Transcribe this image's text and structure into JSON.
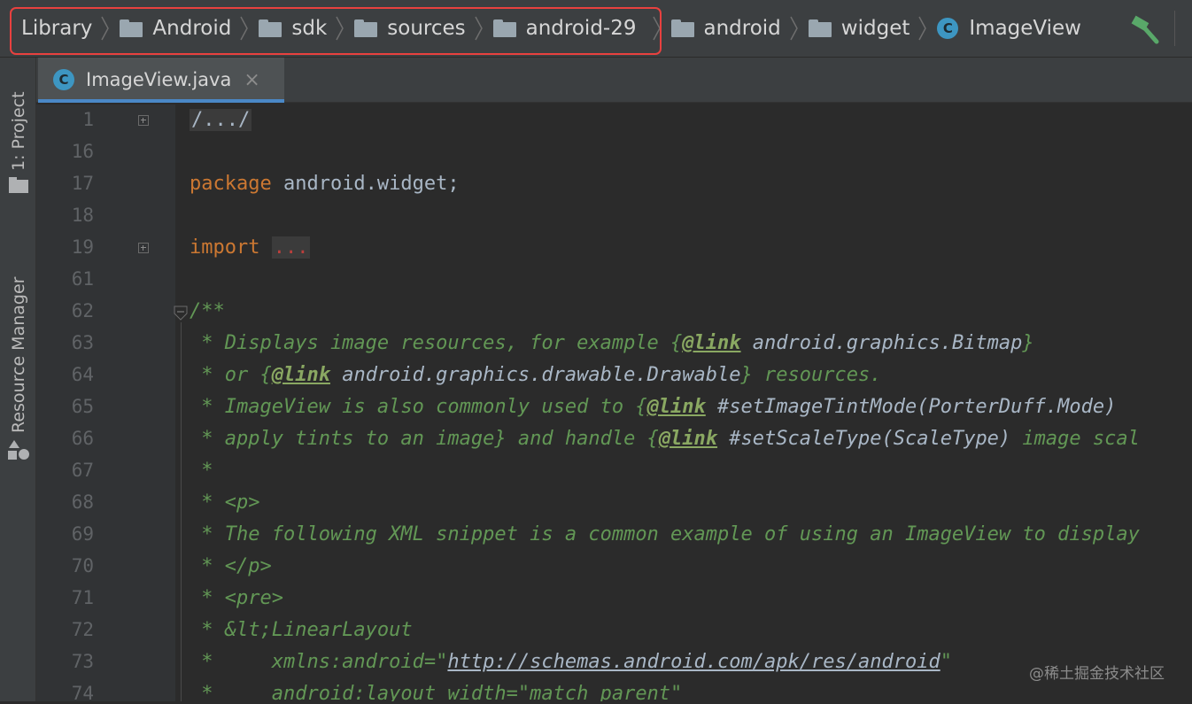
{
  "breadcrumb": [
    {
      "label": "Library",
      "icon": "none"
    },
    {
      "label": "Android",
      "icon": "folder-icon"
    },
    {
      "label": "sdk",
      "icon": "folder-icon"
    },
    {
      "label": "sources",
      "icon": "folder-icon"
    },
    {
      "label": "android-29",
      "icon": "folder-icon"
    },
    {
      "label": "android",
      "icon": "folder-icon"
    },
    {
      "label": "widget",
      "icon": "folder-icon"
    },
    {
      "label": "ImageView",
      "icon": "class-icon"
    }
  ],
  "class_icon_letter": "C",
  "side_strip": {
    "project_label": "1: Project",
    "resource_label": "Resource Manager"
  },
  "tab": {
    "title": "ImageView.java",
    "close": "×"
  },
  "line_numbers": [
    "1",
    "16",
    "17",
    "18",
    "19",
    "61",
    "62",
    "63",
    "64",
    "65",
    "66",
    "67",
    "68",
    "69",
    "70",
    "71",
    "72",
    "73",
    "74"
  ],
  "code": {
    "l1": "/.../",
    "l17_kw": "package",
    "l17_rest": " android.widget;",
    "l19_kw": "import",
    "l19_dots": "...",
    "l62": "/**",
    "l63a": " * Displays image resources, for example {",
    "l63tag": "@link",
    "l63ref": " android.graphics.Bitmap",
    "l63b": "}",
    "l64a": " * or {",
    "l64tag": "@link",
    "l64ref": " android.graphics.drawable.Drawable",
    "l64b": "} resources.",
    "l65a": " * ImageView is also commonly used to {",
    "l65tag": "@link",
    "l65ref": " #setImageTintMode(PorterDuff.Mode)",
    "l66a": " * apply tints to an image} and handle {",
    "l66tag": "@link",
    "l66ref": " #setScaleType(ScaleType)",
    "l66b": " image scal",
    "l67": " *",
    "l68": " * <p>",
    "l69": " * The following XML snippet is a common example of using an ImageView to display",
    "l70": " * </p>",
    "l71": " * <pre>",
    "l72": " * &lt;LinearLayout",
    "l73a": " *     xmlns:android=\"",
    "l73link": "http://schemas.android.com/apk/res/android",
    "l73b": "\"",
    "l74": " *     android:layout_width=\"match_parent\""
  },
  "watermark": "@稀土掘金技术社区",
  "colors": {
    "background": "#2b2b2b",
    "highlight": "#e8413f",
    "keyword": "#cc7832",
    "doc_comment": "#629755",
    "tab_accent": "#4a88c7"
  }
}
